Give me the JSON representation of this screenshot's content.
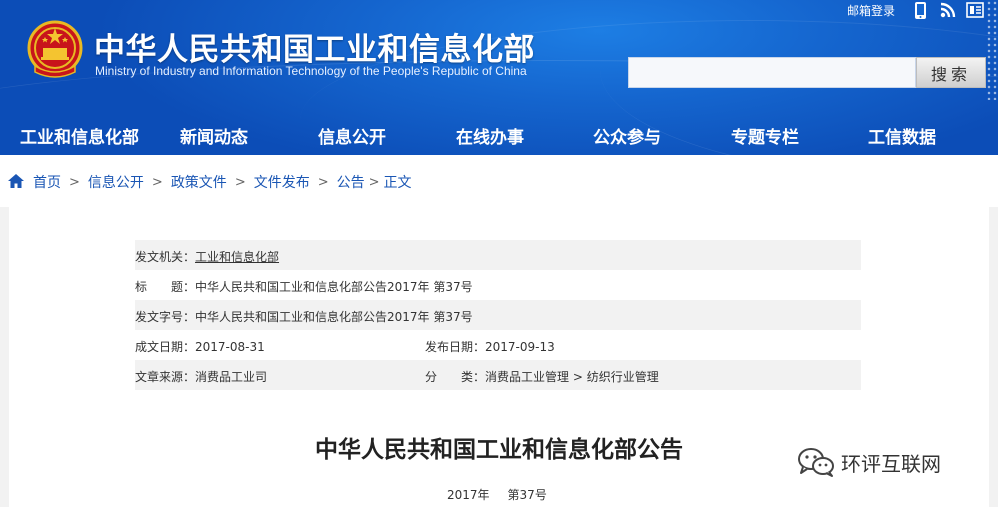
{
  "header": {
    "title_cn": "中华人民共和国工业和信息化部",
    "title_en": "Ministry of Industry and Information Technology of the People's Republic of China",
    "mail_login": "邮箱登录",
    "top_icons": [
      "mobile-icon",
      "rss-icon",
      "weibo-icon"
    ],
    "search_placeholder": "",
    "search_button": "搜索",
    "colors": {
      "banner": "#1566cf",
      "banner_dark": "#0c4db7",
      "link": "#1a56b4"
    }
  },
  "nav": {
    "items": [
      "工业和信息化部",
      "新闻动态",
      "信息公开",
      "在线办事",
      "公众参与",
      "专题专栏",
      "工信数据"
    ]
  },
  "breadcrumb": {
    "items": [
      "首页",
      "信息公开",
      "政策文件",
      "文件发布",
      "公告"
    ],
    "current": "正文",
    "separator": ">"
  },
  "meta": {
    "issuer_label": "发文机关：",
    "issuer_value": "工业和信息化部",
    "title_label": "标　　题：",
    "title_value": "中华人民共和国工业和信息化部公告2017年 第37号",
    "doc_no_label": "发文字号：",
    "doc_no_value": "中华人民共和国工业和信息化部公告2017年 第37号",
    "created_label": "成文日期：",
    "created_value": "2017-08-31",
    "published_label": "发布日期：",
    "published_value": "2017-09-13",
    "source_label": "文章来源：",
    "source_value": "消费品工业司",
    "category_label": "分　　类：",
    "category_value": "消费品工业管理 > 纺织行业管理"
  },
  "document": {
    "title": "中华人民共和国工业和信息化部公告",
    "year": "2017年",
    "number": "第37号"
  },
  "watermark": {
    "text": "环评互联网"
  }
}
